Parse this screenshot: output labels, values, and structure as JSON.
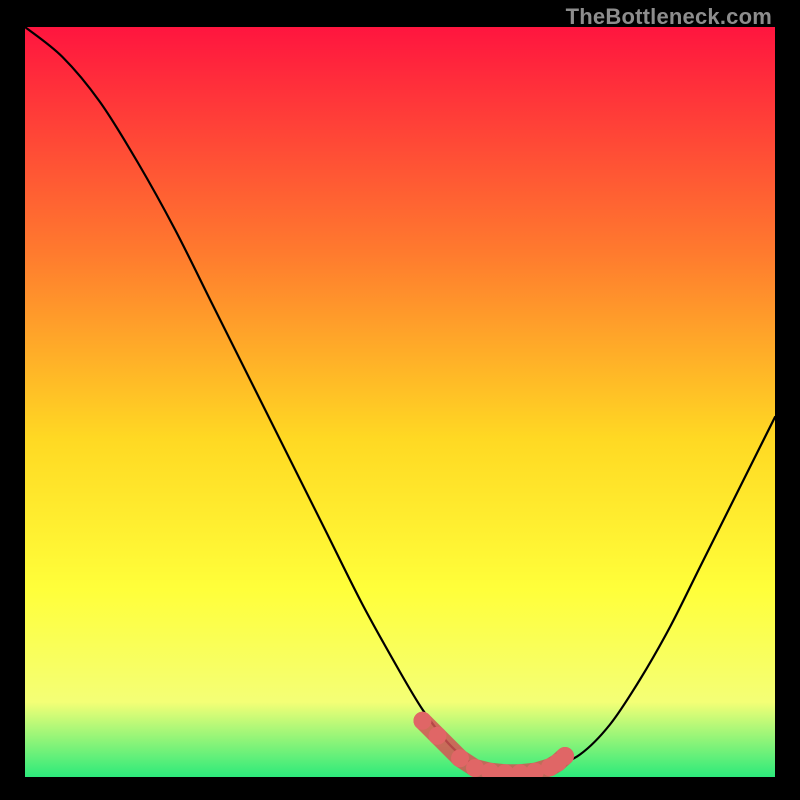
{
  "watermark": "TheBottleneck.com",
  "colors": {
    "gradient_top": "#ff153f",
    "gradient_mid1": "#ff7a2e",
    "gradient_mid2": "#ffd923",
    "gradient_mid3": "#ffff3a",
    "gradient_mid4": "#f4ff76",
    "gradient_bottom": "#2cea7b",
    "curve": "#000000",
    "marker_fill": "#e06666",
    "marker_stroke": "#d45454"
  },
  "chart_data": {
    "type": "line",
    "title": "",
    "xlabel": "",
    "ylabel": "",
    "xlim": [
      0,
      100
    ],
    "ylim": [
      0,
      100
    ],
    "series": [
      {
        "name": "bottleneck-curve",
        "x": [
          0,
          5,
          10,
          15,
          20,
          25,
          30,
          35,
          40,
          45,
          50,
          53,
          56,
          58,
          60,
          62,
          64,
          66,
          68,
          70,
          74,
          78,
          82,
          86,
          90,
          94,
          98,
          100
        ],
        "y": [
          100,
          96,
          90,
          82,
          73,
          63,
          53,
          43,
          33,
          23,
          14,
          9,
          5,
          3,
          1.5,
          0.8,
          0.5,
          0.5,
          0.7,
          1.2,
          3,
          7,
          13,
          20,
          28,
          36,
          44,
          48
        ]
      }
    ],
    "markers": {
      "name": "highlight-dots",
      "x": [
        53,
        55,
        58,
        60,
        62,
        64,
        66,
        68,
        70,
        71,
        72
      ],
      "y": [
        7.5,
        5.5,
        2.5,
        1.2,
        0.7,
        0.5,
        0.5,
        0.7,
        1.3,
        1.9,
        2.8
      ]
    }
  }
}
